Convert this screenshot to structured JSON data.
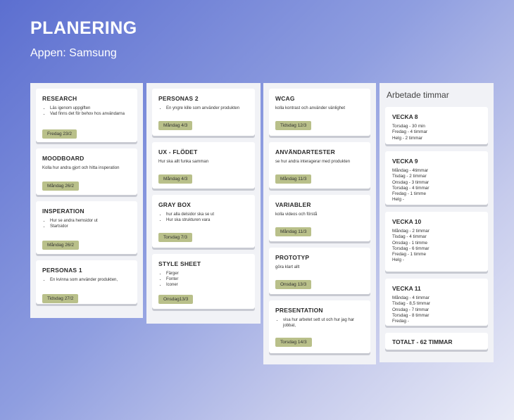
{
  "header": {
    "title": "PLANERING",
    "subtitle": "Appen: Samsung"
  },
  "columns": [
    {
      "cards": [
        {
          "title": "RESEARCH",
          "bullets": [
            "Läs igenom uppgiften",
            "Vad finns det för behov hos användarna"
          ],
          "tag": "Fredag 23/2"
        },
        {
          "title": "MOODBOARD",
          "text": "Kolla hur andra gjort och hitta insperation",
          "tag": "Måndag  26/2"
        },
        {
          "title": "INSPERATION",
          "bullets": [
            "Hur se andra hemsidor ut",
            "Startsidor"
          ],
          "tag": "Måndag 26/2"
        },
        {
          "title": "PERSONAS 1",
          "bullets": [
            "En kvinna som använder produkten,"
          ],
          "tag": "Tidsdag 27/2"
        }
      ]
    },
    {
      "cards": [
        {
          "title": "PERSONAS 2",
          "bullets": [
            "En yngre kille som använder produkten"
          ],
          "tag": "Måndag 4/3"
        },
        {
          "title": "UX - FLÖDET",
          "text": "Hur ska allt funka samman",
          "tag": "Måndag 4/3"
        },
        {
          "title": "GRAY BOX",
          "bullets": [
            "hur alla delsidor ska se ut",
            "Hur ska strukturen vara"
          ],
          "tag": "Torsdag 7/3"
        },
        {
          "title": "STYLE SHEET",
          "bullets": [
            "Färger",
            "Fonter",
            "Iconer"
          ],
          "tag": "Onsdag13/3"
        }
      ]
    },
    {
      "cards": [
        {
          "title": "WCAG",
          "text": "kolla kontrast och använder vänlighet",
          "tag": "Tidsdag 12/3"
        },
        {
          "title": "ANVÄNDARTESTER",
          "text": "se hur andra interagerar med produkten",
          "tag": "Måndag 11/3"
        },
        {
          "title": "VARIABLER",
          "text": "kolla videos och förstå",
          "tag": "Måndag 11/3"
        },
        {
          "title": "PROTOTYP",
          "text": "göra klart allt",
          "tag": "Onsdag 13/3"
        },
        {
          "title": "PRESENTATION",
          "bullets": [
            "visa hur arbetet sett ut och hur jag har jobbat,"
          ],
          "tag": "Torsdag 14/3"
        }
      ]
    }
  ],
  "hours": {
    "title": "Arbetade timmar",
    "weeks": [
      {
        "title": "VECKA 8",
        "lines": [
          "Torsdag - 30 min",
          "Fredag - 4 timmar",
          "Helg - 2 timmar"
        ]
      },
      {
        "title": "VECKA 9",
        "lines": [
          "Måndag - 4timmar",
          "Tisdag - 2 timmar",
          "Onsdag - 3 timmar",
          "Torsdag - 4 timmar",
          "Fredag - 1 timme",
          "Helg -"
        ]
      },
      {
        "title": "VECKA 10",
        "lines": [
          "Måndag - 2 timmar",
          "Tisdag - 4 timmar",
          "Onsdag - 1 timme",
          "Torsdag - 6 timmar",
          "Fredag - 1 timme",
          "Helg -"
        ]
      },
      {
        "title": "VECKA 11",
        "lines": [
          "Måndag - 4 timmar",
          "Tisdag - 8,5 timmar",
          "Onsdag - 7 timmar",
          "Torsdag - 8 timmar",
          "Fredag -"
        ]
      }
    ],
    "total": "TOTALT -  62 TIMMAR"
  }
}
